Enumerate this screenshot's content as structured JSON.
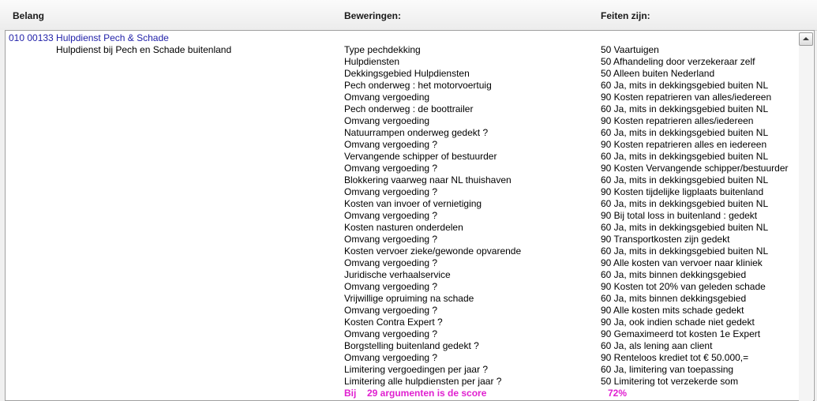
{
  "columns": {
    "belang": "Belang",
    "beweringen": "Beweringen:",
    "feiten": "Feiten zijn:"
  },
  "group": {
    "code_title": "010 00133 Hulpdienst Pech & Schade",
    "subtitle": "Hulpdienst bij Pech en Schade buitenland"
  },
  "rows": [
    {
      "argument": "Type pechdekking",
      "fact": "50 Vaartuigen"
    },
    {
      "argument": "Hulpdiensten",
      "fact": "50 Afhandeling door verzekeraar zelf"
    },
    {
      "argument": "Dekkingsgebied Hulpdiensten",
      "fact": "50 Alleen buiten Nederland"
    },
    {
      "argument": "Pech onderweg : het motorvoertuig",
      "fact": "60 Ja, mits in dekkingsgebied buiten NL"
    },
    {
      "argument": "Omvang vergoeding",
      "fact": "90 Kosten repatrieren van alles/iedereen"
    },
    {
      "argument": "Pech onderweg : de boottrailer",
      "fact": "60 Ja, mits in dekkingsgebied buiten NL"
    },
    {
      "argument": "Omvang vergoeding",
      "fact": "90 Kosten repatrieren alles/iedereen"
    },
    {
      "argument": "Natuurrampen onderweg gedekt ?",
      "fact": "60 Ja, mits in dekkingsgebied buiten NL"
    },
    {
      "argument": "Omvang vergoeding ?",
      "fact": "90 Kosten repatrieren alles en iedereen"
    },
    {
      "argument": "Vervangende schipper of bestuurder",
      "fact": "60 Ja, mits in dekkingsgebied buiten NL"
    },
    {
      "argument": "Omvang vergoeding ?",
      "fact": "90 Kosten Vervangende schipper/bestuurder"
    },
    {
      "argument": "Blokkering vaarweg naar NL thuishaven",
      "fact": "60 Ja, mits in dekkingsgebied buiten NL"
    },
    {
      "argument": "Omvang vergoeding ?",
      "fact": "90 Kosten tijdelijke ligplaats buitenland"
    },
    {
      "argument": "Kosten van invoer of vernietiging",
      "fact": "60 Ja, mits in dekkingsgebied buiten NL"
    },
    {
      "argument": "Omvang vergoeding ?",
      "fact": "90 Bij total loss in buitenland : gedekt"
    },
    {
      "argument": "Kosten nasturen onderdelen",
      "fact": "60 Ja, mits in dekkingsgebied buiten NL"
    },
    {
      "argument": "Omvang vergoeding ?",
      "fact": "90 Transportkosten zijn gedekt"
    },
    {
      "argument": "Kosten vervoer zieke/gewonde opvarende",
      "fact": "60 Ja, mits in dekkingsgebied buiten NL"
    },
    {
      "argument": "Omvang vergoeding ?",
      "fact": "90 Alle kosten van vervoer naar kliniek"
    },
    {
      "argument": "Juridische verhaalservice",
      "fact": "60 Ja, mits binnen dekkingsgebied"
    },
    {
      "argument": "Omvang vergoeding ?",
      "fact": "90 Kosten tot 20% van geleden schade"
    },
    {
      "argument": "Vrijwillige opruiming na schade",
      "fact": "60 Ja, mits binnen dekkingsgebied"
    },
    {
      "argument": "Omvang vergoeding ?",
      "fact": "90 Alle kosten mits schade gedekt"
    },
    {
      "argument": "Kosten Contra Expert ?",
      "fact": "90 Ja, ook indien schade niet gedekt"
    },
    {
      "argument": "Omvang vergoeding ?",
      "fact": "90 Gemaximeerd tot kosten 1e Expert"
    },
    {
      "argument": "Borgstelling buitenland gedekt ?",
      "fact": "60 Ja, als lening aan client"
    },
    {
      "argument": "Omvang vergoeding ?",
      "fact": "90 Renteloos krediet tot € 50.000,="
    },
    {
      "argument": "Limitering vergoedingen per jaar ?",
      "fact": "60 Ja, limitering van toepassing"
    },
    {
      "argument": "Limitering alle hulpdiensten per jaar ?",
      "fact": "50 Limitering tot verzekerde som"
    }
  ],
  "summary": {
    "prefix": "Bij",
    "text": "29 argumenten is de score",
    "score": "72%"
  },
  "colors": {
    "group_title": "#1f1fa8",
    "summary": "#e020d0"
  },
  "icons": {
    "scroll_up": "arrow-up-icon"
  }
}
